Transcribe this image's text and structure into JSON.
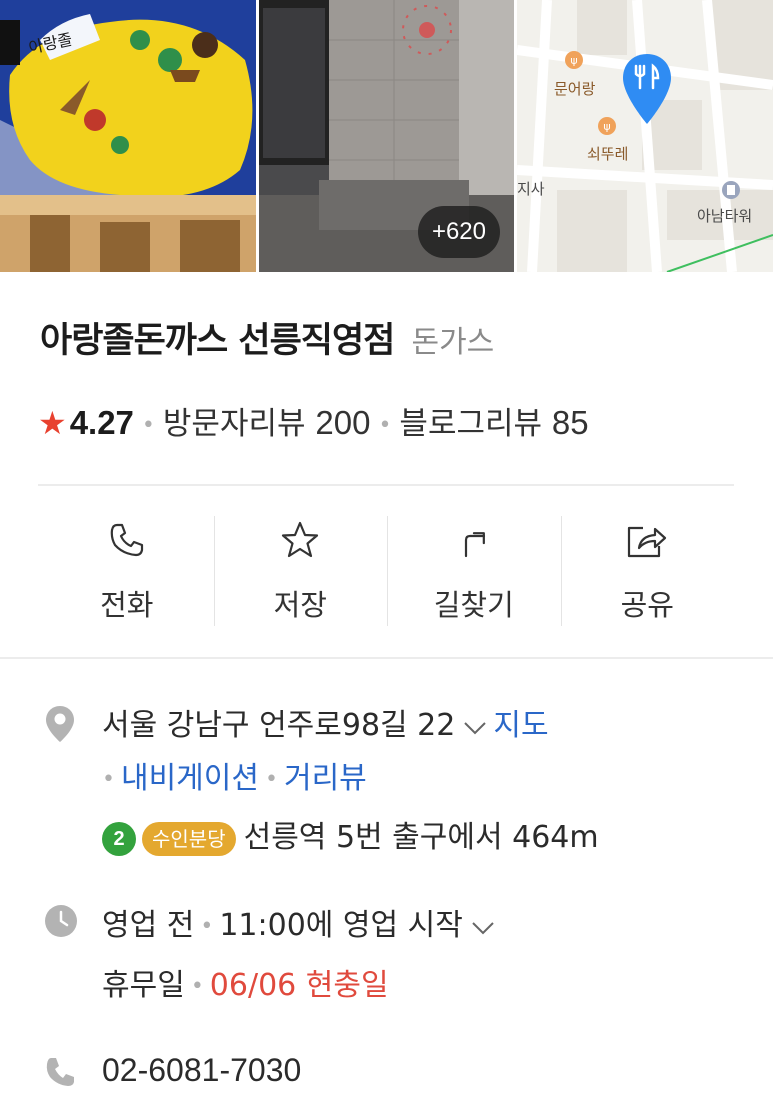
{
  "photos": {
    "more_count": "+620",
    "photo1_text": "아랑졸",
    "map_labels": {
      "munorang": "문어랑",
      "soettukkeuk": "쇠뚜레",
      "jisa": "지사",
      "anam_tower": "아남타워"
    },
    "map_pin_color": "#2f8cf3"
  },
  "place": {
    "title": "아랑졸돈까스 선릉직영점",
    "category": "돈가스",
    "rating": "4.27",
    "visitor_review_label": "방문자리뷰",
    "visitor_review_count": "200",
    "blog_review_label": "블로그리뷰",
    "blog_review_count": "85",
    "star_color": "#e8412f"
  },
  "actions": [
    {
      "label": "전화",
      "icon": "phone-icon"
    },
    {
      "label": "저장",
      "icon": "star-outline-icon"
    },
    {
      "label": "길찾기",
      "icon": "directions-icon"
    },
    {
      "label": "공유",
      "icon": "share-icon"
    }
  ],
  "address": {
    "text": "서울 강남구 언주로98길 22",
    "map_link": "지도",
    "navigation_link": "내비게이션",
    "streetview_link": "거리뷰",
    "subway_line": "2",
    "subway_line_color": "#33a23d",
    "suin_bundang": "수인분당",
    "suin_bundang_color": "#e4a82f",
    "station_info": "선릉역 5번 출구에서 464m"
  },
  "hours": {
    "status": "영업 전",
    "open_info": "11:00에 영업 시작",
    "holiday_label": "휴무일",
    "holiday_value": "06/06 현충일"
  },
  "phone": {
    "number": "02-6081-7030"
  },
  "link_color": "#2a67c8"
}
